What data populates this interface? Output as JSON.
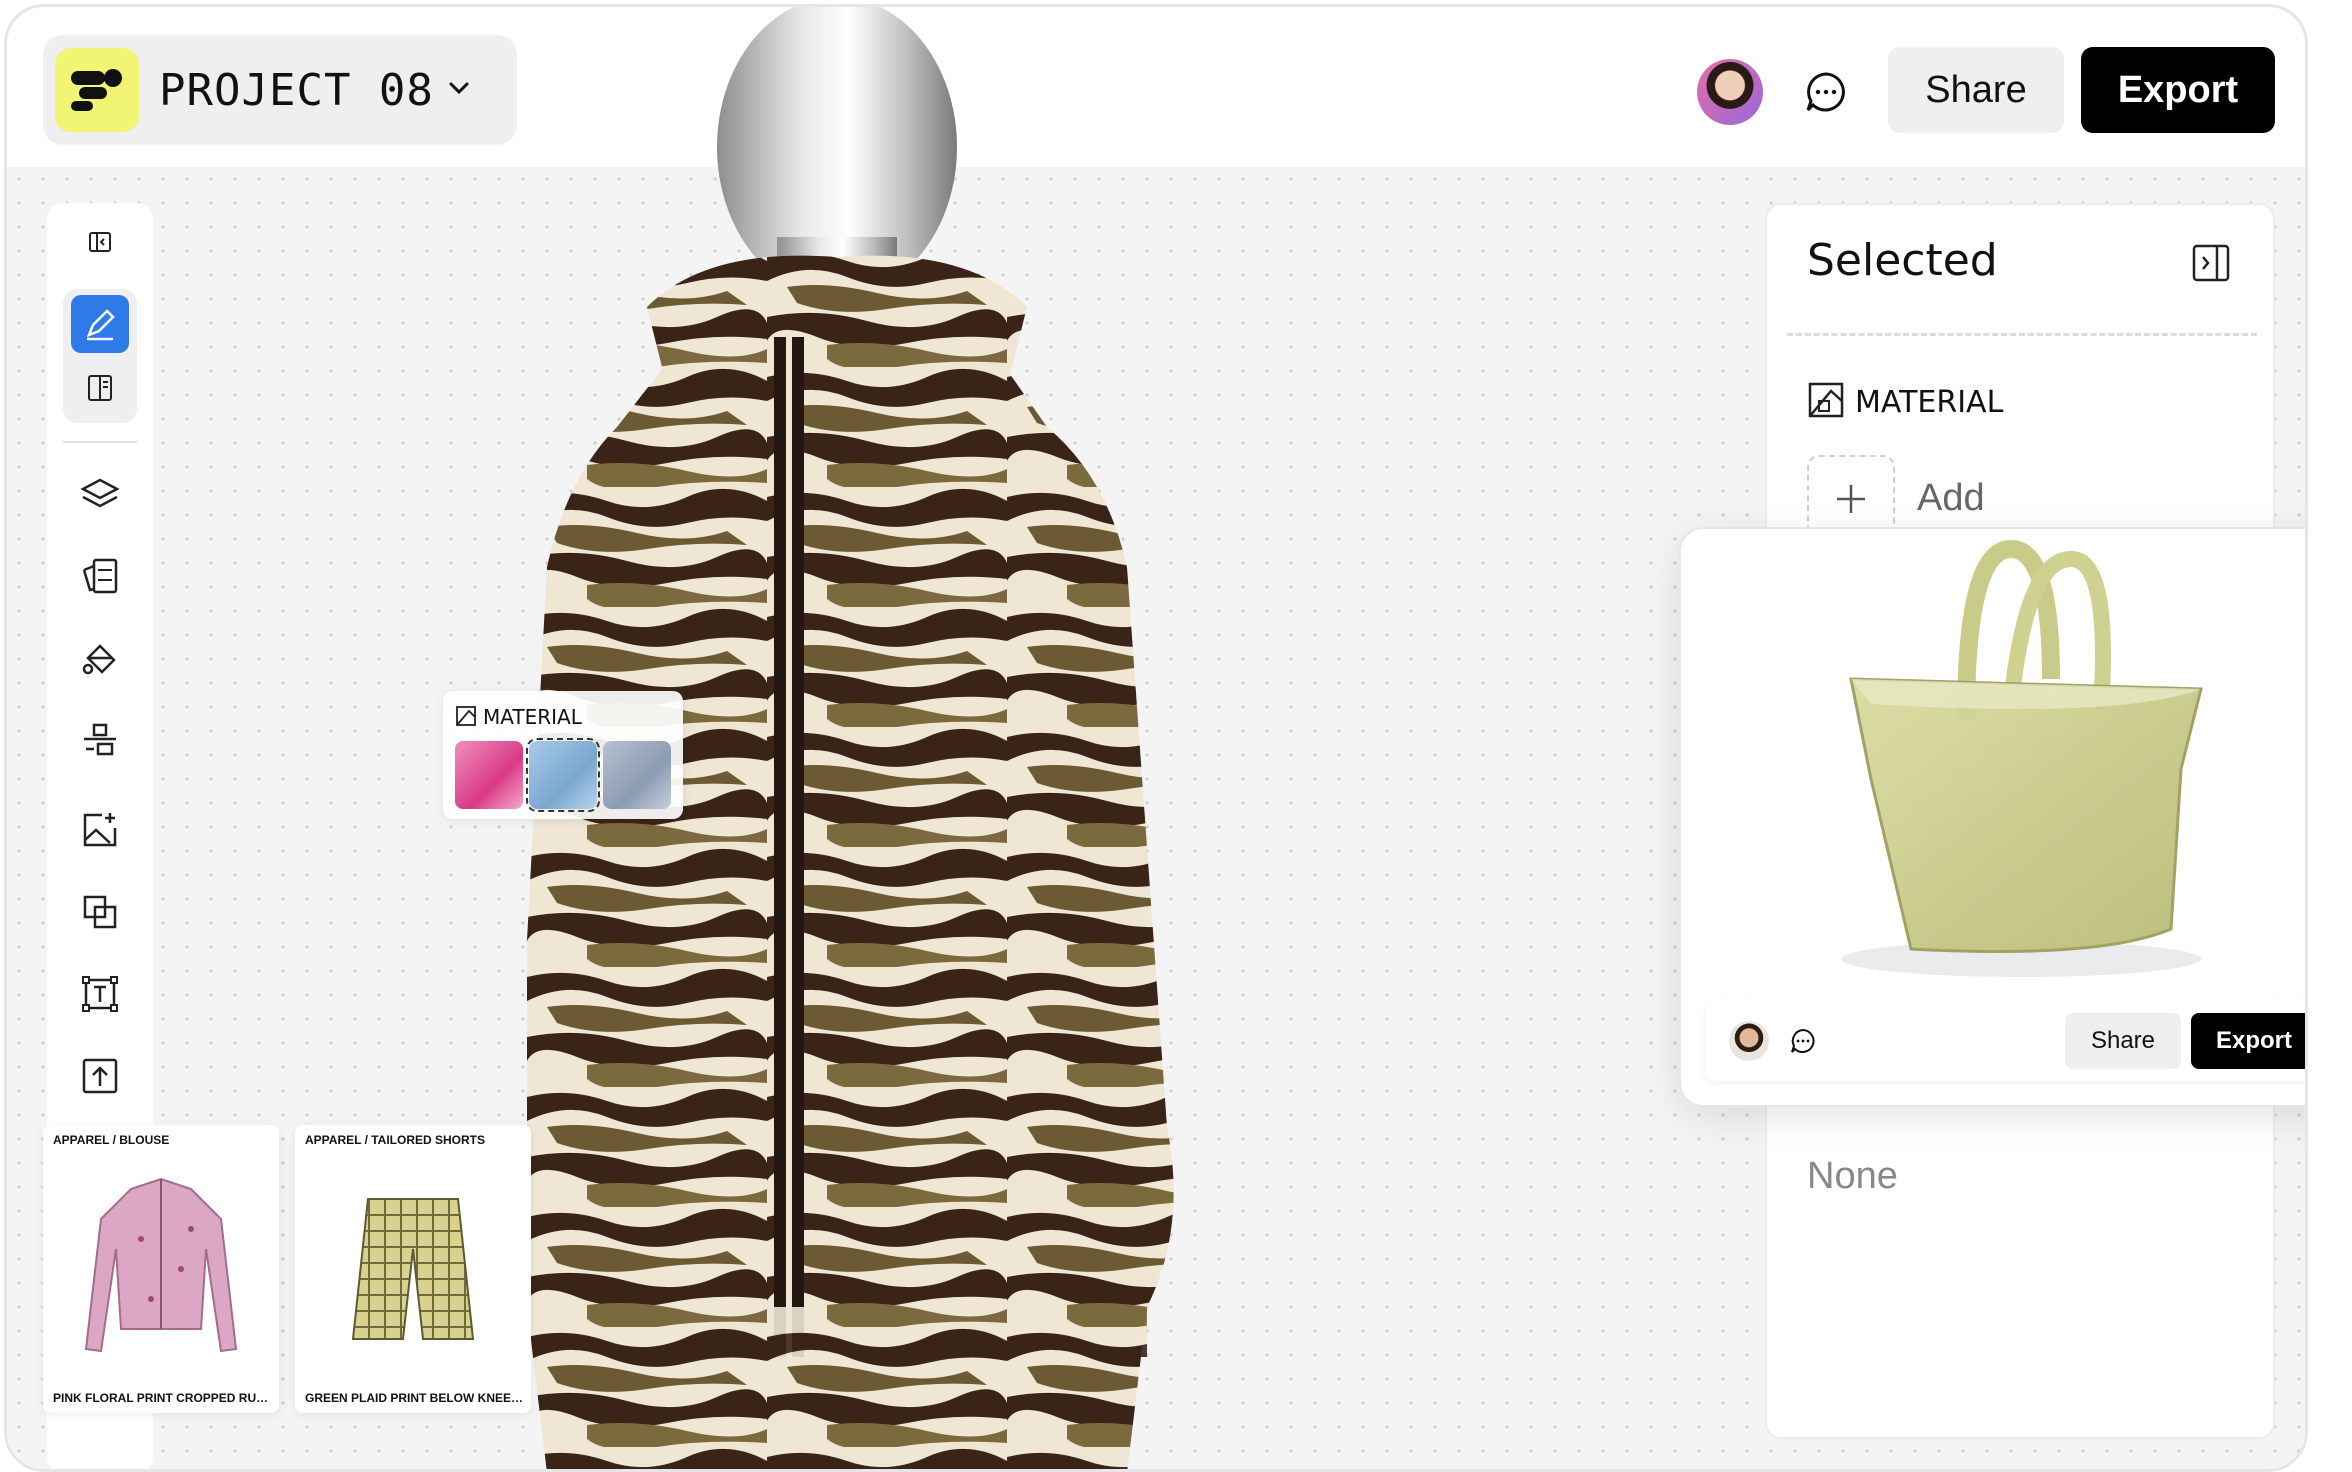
{
  "project": {
    "title": "PROJECT 08"
  },
  "header": {
    "share_label": "Share",
    "export_label": "Export"
  },
  "toolbar": {
    "items": [
      "collapse-sidebar-icon",
      "pen-tool-icon",
      "notes-icon",
      "layers-icon",
      "material-library-icon",
      "paint-bucket-icon",
      "align-icon",
      "add-image-icon",
      "duplicate-icon",
      "text-frame-icon",
      "upload-icon"
    ]
  },
  "material_card": {
    "label": "MATERIAL",
    "swatches": [
      "#e0529a",
      "#8db7d9",
      "#9aa9be"
    ]
  },
  "right_panel": {
    "title": "Selected",
    "material_label": "MATERIAL",
    "add_label": "Add",
    "none_label": "None"
  },
  "bag_card": {
    "share_label": "Share",
    "export_label": "Export",
    "bag_color": "#cfd08e"
  },
  "products": [
    {
      "category": "APPAREL / BLOUSE",
      "name": "PINK FLORAL PRINT CROPPED RUCHED..."
    },
    {
      "category": "APPAREL / TAILORED SHORTS",
      "name": "GREEN PLAID PRINT BELOW KNEE WIDE..."
    }
  ],
  "colors": {
    "accent": "#2d7ae8",
    "logo_bg": "#f2f574",
    "export_bg": "#000000"
  }
}
